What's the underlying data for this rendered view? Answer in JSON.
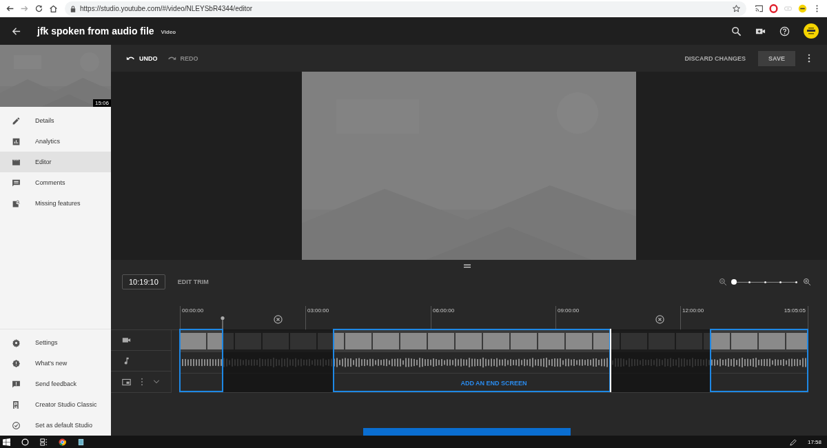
{
  "browser": {
    "url": "https://studio.youtube.com/#/video/NLEYSbR4344/editor"
  },
  "header": {
    "title": "jfk spoken from audio file",
    "subtitle": "Video"
  },
  "thumbnail": {
    "kind": "picture",
    "duration": "15:06"
  },
  "nav": [
    {
      "label": "Details",
      "kind": "pencil",
      "selected": false
    },
    {
      "label": "Analytics",
      "kind": "chart",
      "selected": false
    },
    {
      "label": "Editor",
      "kind": "clapper",
      "selected": true
    },
    {
      "label": "Comments",
      "kind": "comment",
      "selected": false
    },
    {
      "label": "Missing features",
      "kind": "docsearch",
      "selected": false
    }
  ],
  "nav_bottom": [
    {
      "label": "Settings",
      "kind": "gear"
    },
    {
      "label": "What's new",
      "kind": "alert"
    },
    {
      "label": "Send feedback",
      "kind": "feedback"
    },
    {
      "label": "Creator Studio Classic",
      "kind": "exit"
    },
    {
      "label": "Set as default Studio",
      "kind": "check"
    }
  ],
  "toolbar": {
    "actions": [
      {
        "label": "UNDO",
        "kind": "undo",
        "disabled": false
      },
      {
        "label": "REDO",
        "kind": "redo",
        "disabled": true
      }
    ],
    "discard": "DISCARD CHANGES",
    "save": "SAVE"
  },
  "timeline": {
    "time": "10:19:10",
    "edit_trim": "EDIT TRIM",
    "zoom": {
      "level": 0
    },
    "ruler": [
      "00:00:00",
      "03:00:00",
      "06:00:00",
      "09:00:00",
      "12:00:00",
      "15:05:05"
    ],
    "end_screen": "ADD AN END SCREEN"
  },
  "taskbar": {
    "clock": "17:58"
  }
}
